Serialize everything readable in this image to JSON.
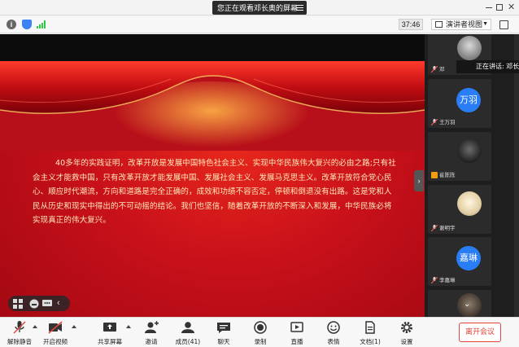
{
  "titlebar": {
    "share_notice": "您正在观看邓长奥的屏幕"
  },
  "toolbar": {
    "timer": "37:46",
    "view_mode": "演讲者视图"
  },
  "slide": {
    "paragraph": "40多年的实践证明，改革开放是发展中国特色社会主义、实现中华民族伟大复兴的必由之路;只有社会主义才能救中国，只有改革开放才能发展中国、发展社会主义、发展马克思主义。改革开放符合党心民心、顺应时代潮流，方向和道路是完全正确的，成效和功绩不容否定，停顿和倒退没有出路。这是党和人民从历史和现实中得出的不可动摇的结论。我们也坚信，随着改革开放的不断深入和发展，中华民族必将实现真正的伟大复兴。"
  },
  "panel": {
    "speaking_label": "正在讲话: 邓长",
    "participants": [
      {
        "name": "邓",
        "avatar": "",
        "type": "photo"
      },
      {
        "name": "王万羽",
        "avatar": "万羽",
        "type": "initials"
      },
      {
        "name": "崔陈陈",
        "avatar": "",
        "type": "photo"
      },
      {
        "name": "谢明宇",
        "avatar": "",
        "type": "photo"
      },
      {
        "name": "李嘉琳",
        "avatar": "嘉琳",
        "type": "initials"
      },
      {
        "name": "",
        "avatar": "",
        "type": "photo"
      }
    ]
  },
  "controls": {
    "mute": "解除静音",
    "video": "开启视频",
    "share": "共享屏幕",
    "invite": "邀请",
    "members": "成员(41)",
    "chat": "聊天",
    "record": "录制",
    "live": "直播",
    "reactions": "表情",
    "docs": "文档(1)",
    "settings": "设置",
    "leave": "离开会议"
  },
  "colors": {
    "accent_red": "#e0443a",
    "avatar_blue": "#2a7ef5",
    "slide_text": "#ffe9b8"
  }
}
